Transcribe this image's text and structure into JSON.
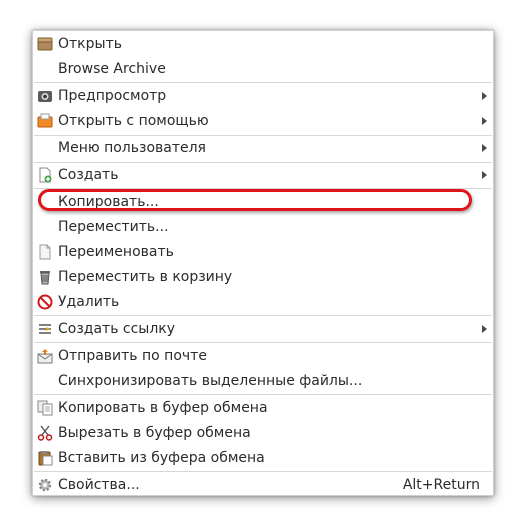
{
  "menu": {
    "items": [
      {
        "label": "Открыть",
        "icon": "archive-box-icon"
      },
      {
        "label": "Browse Archive"
      },
      {
        "label": "Предпросмотр",
        "icon": "preview-icon",
        "submenu": true
      },
      {
        "label": "Открыть с помощью",
        "icon": "open-with-icon",
        "submenu": true
      },
      {
        "label": "Меню пользователя",
        "submenu": true
      },
      {
        "label": "Создать",
        "icon": "new-document-icon",
        "submenu": true
      },
      {
        "label": "Копировать..."
      },
      {
        "label": "Переместить..."
      },
      {
        "label": "Переименовать",
        "icon": "blank-document-icon"
      },
      {
        "label": "Переместить в корзину",
        "icon": "trash-icon"
      },
      {
        "label": "Удалить",
        "icon": "delete-icon"
      },
      {
        "label": "Создать ссылку",
        "icon": "link-icon",
        "submenu": true
      },
      {
        "label": "Отправить по почте",
        "icon": "send-mail-icon"
      },
      {
        "label": "Синхронизировать выделенные файлы..."
      },
      {
        "label": "Копировать в буфер обмена",
        "icon": "copy-icon"
      },
      {
        "label": "Вырезать в буфер обмена",
        "icon": "scissors-icon"
      },
      {
        "label": "Вставить из буфера обмена",
        "icon": "paste-icon"
      },
      {
        "label": "Свойства...",
        "icon": "gear-icon",
        "shortcut": "Alt+Return"
      }
    ]
  },
  "highlight_color": "#e0141b"
}
